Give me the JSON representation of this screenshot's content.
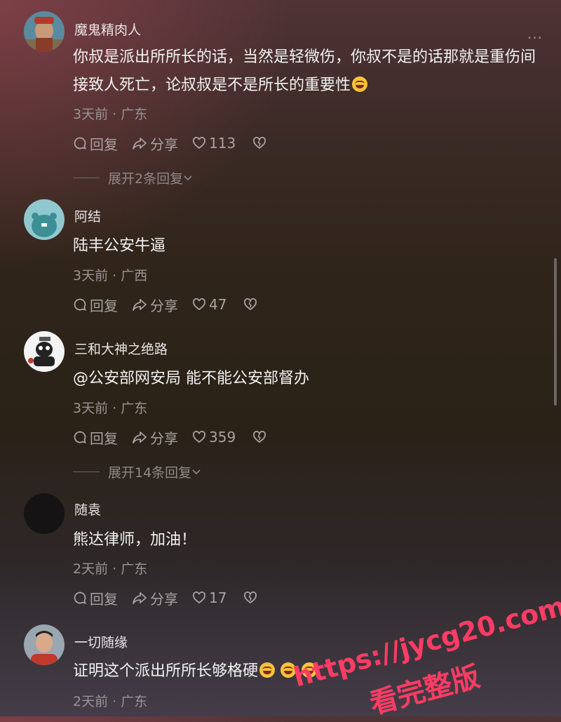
{
  "actions": {
    "reply": "回复",
    "share": "分享"
  },
  "comments": [
    {
      "name": "魔鬼精肉人",
      "text": "你叔是派出所所长的话，当然是轻微伤，你叔不是的话那就是重伤间接致人死亡，论叔叔是不是所长的重要性",
      "meta": "3天前 · 广东",
      "likes": "113",
      "expand": "展开2条回复"
    },
    {
      "name": "阿结",
      "text": "陆丰公安牛逼",
      "meta": "3天前 · 广西",
      "likes": "47"
    },
    {
      "name": "三和大神之绝路",
      "text": "@公安部网安局 能不能公安部督办",
      "meta": "3天前 · 广东",
      "likes": "359",
      "expand": "展开14条回复"
    },
    {
      "name": "随袁",
      "text": "熊达律师，加油！",
      "meta": "2天前 · 广东",
      "likes": "17"
    },
    {
      "name": "一切随缘",
      "text": "证明这个派出所所长够格硬",
      "meta": "2天前 · 广东"
    }
  ],
  "more_label": "···",
  "watermark": {
    "line1": "https://jycg20.com",
    "line2": "看完整版"
  },
  "colors": {
    "background_top": "#4f3335",
    "background_mid": "#2a2217",
    "watermark": "#ff3c64"
  }
}
